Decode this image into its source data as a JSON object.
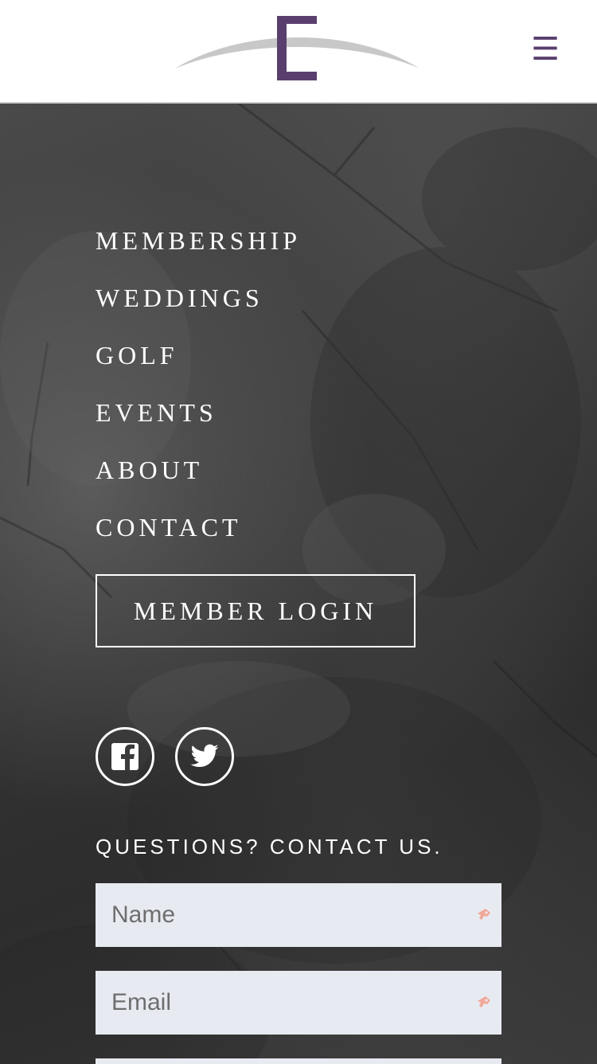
{
  "header": {
    "logo_alt": "logo",
    "menu_icon": "hamburger-menu-icon",
    "brand_color": "#5a3f6e"
  },
  "nav": {
    "items": [
      {
        "label": "MEMBERSHIP"
      },
      {
        "label": "WEDDINGS"
      },
      {
        "label": "GOLF"
      },
      {
        "label": "EVENTS"
      },
      {
        "label": "ABOUT"
      },
      {
        "label": "CONTACT"
      }
    ],
    "login_label": "MEMBER LOGIN"
  },
  "social": {
    "facebook_icon": "facebook-icon",
    "twitter_icon": "twitter-icon"
  },
  "contact": {
    "heading": "QUESTIONS? CONTACT US.",
    "name_placeholder": "Name",
    "email_placeholder": "Email"
  }
}
